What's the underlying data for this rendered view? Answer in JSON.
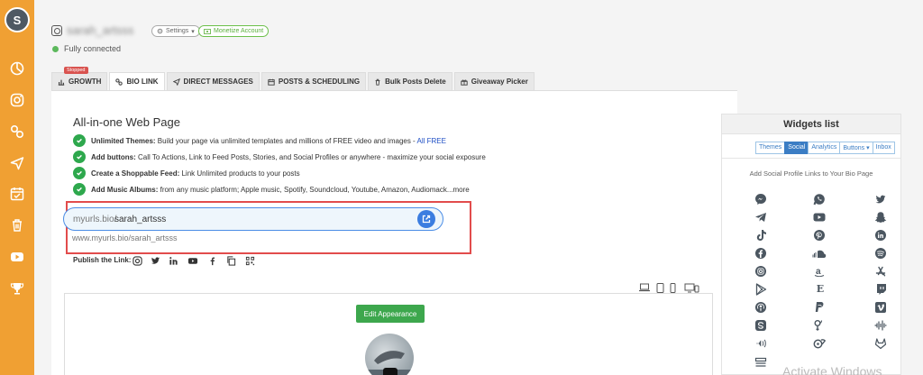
{
  "user": {
    "avatar_letter": "S"
  },
  "rail": {
    "icons": [
      "pie-chart-icon",
      "instagram-icon",
      "link-icon",
      "send-icon",
      "calendar-check-icon",
      "trash-icon",
      "youtube-icon",
      "trophy-icon"
    ]
  },
  "header": {
    "account_name": "sarah_artsss",
    "settings_label": "Settings",
    "monetize_label": "Monetize Account",
    "status": "Fully connected"
  },
  "tabs": [
    {
      "label": "GROWTH",
      "icon": "bar-chart-icon",
      "badge": "Stopped"
    },
    {
      "label": "BIO LINK",
      "icon": "link-icon",
      "active": true
    },
    {
      "label": "DIRECT MESSAGES",
      "icon": "send-icon"
    },
    {
      "label": "POSTS & SCHEDULING",
      "icon": "calendar-icon"
    },
    {
      "label": "Bulk Posts Delete",
      "icon": "trash-icon"
    },
    {
      "label": "Giveaway Picker",
      "icon": "gift-icon"
    }
  ],
  "main": {
    "title": "All-in-one Web Page",
    "features": [
      {
        "bold": "Unlimited Themes:",
        "text": " Build your page via unlimited templates and millions of FREE video and images - ",
        "link": "All FREE"
      },
      {
        "bold": "Add buttons:",
        "text": " Call To Actions, Link to Feed Posts, Stories, and Social Profiles or anywhere - maximize your social exposure",
        "link": ""
      },
      {
        "bold": "Create a Shoppable Feed:",
        "text": " Link Unlimited products to your posts",
        "link": ""
      },
      {
        "bold": "Add Music Albums:",
        "text": " from any music platform; Apple music, Spotify, Soundcloud, Youtube, Amazon, Audiomack...more",
        "link": ""
      }
    ],
    "url": {
      "prefix": "myurls.bio/",
      "slug": "sarah_artsss",
      "full": "www.myurls.bio/sarah_artsss"
    },
    "publish_label": "Publish the Link:",
    "share_icons": [
      "instagram-icon",
      "twitter-icon",
      "linkedin-icon",
      "youtube-icon",
      "facebook-icon",
      "copy-icon",
      "qr-code-icon"
    ],
    "device_icons": [
      "laptop-icon",
      "tablet-icon",
      "phone-icon",
      "desktop-mobile-icon"
    ],
    "edit_button": "Edit Appearance"
  },
  "widgets": {
    "title": "Widgets list",
    "tabs": [
      "Themes",
      "Social",
      "Analytics",
      "Buttons ▾",
      "Inbox"
    ],
    "active_tab": "Social",
    "subtitle": "Add Social Profile Links to Your Bio Page",
    "icons": [
      "messenger-icon",
      "whatsapp-icon",
      "twitter-icon",
      "telegram-icon",
      "youtube-icon",
      "snapchat-icon",
      "tiktok-icon",
      "pinterest-icon",
      "linkedin-icon",
      "facebook-icon",
      "soundcloud-icon",
      "spotify-icon",
      "instagram-icon",
      "amazon-icon",
      "app-store-icon",
      "google-play-icon",
      "etsy-icon",
      "twitch-icon",
      "podcasts-icon",
      "paypal-icon",
      "vimeo-icon",
      "skype-icon",
      "cashapp-icon",
      "audiomack-icon",
      "clubhouse-icon",
      "onlyfans-icon",
      "gitlab-icon",
      "bandcamp-icon"
    ]
  },
  "watermark": "Activate Windows",
  "colors": {
    "rail": "#f0a033",
    "accent": "#3b7de0",
    "success": "#2ea84d",
    "highlight": "#e24c4c"
  }
}
